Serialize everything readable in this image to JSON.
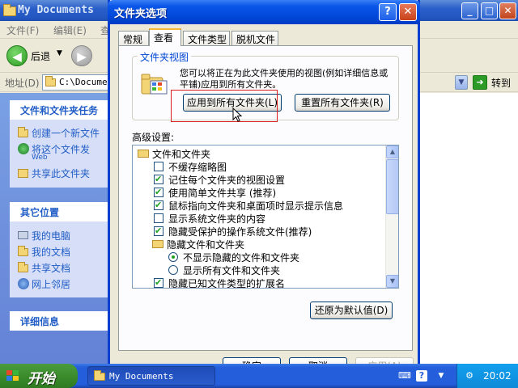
{
  "explorer": {
    "title": "My Documents",
    "menu": [
      "文件(F)",
      "编辑(E)",
      "查"
    ],
    "back_label": "后退",
    "address_label": "地址(D)",
    "address_value": "C:\\Documen",
    "go_label": "转到",
    "tasks_title": "文件和文件夹任务",
    "tasks": [
      "创建一个新文件",
      "将这个文件发",
      "Web",
      "共享此文件夹"
    ],
    "other_title": "其它位置",
    "other": [
      "我的电脑",
      "我的文档",
      "共享文档",
      "网上邻居"
    ],
    "details_title": "详细信息"
  },
  "dialog": {
    "title": "文件夹选项",
    "help_label": "?",
    "close_label": "✕",
    "tabs": [
      "常规",
      "查看",
      "文件类型",
      "脱机文件"
    ],
    "active_tab": "查看",
    "folder_view": {
      "legend": "文件夹视图",
      "description": "您可以将正在为此文件夹使用的视图(例如详细信息或平铺)应用到所有文件夹。",
      "apply_all": "应用到所有文件夹(L)",
      "reset_all": "重置所有文件夹(R)"
    },
    "advanced_label": "高级设置:",
    "advanced_items": [
      {
        "type": "folder",
        "label": "文件和文件夹"
      },
      {
        "type": "checkbox",
        "checked": false,
        "label": "不缓存缩略图"
      },
      {
        "type": "checkbox",
        "checked": true,
        "label": "记住每个文件夹的视图设置"
      },
      {
        "type": "checkbox",
        "checked": true,
        "label": "使用简单文件共享 (推荐)"
      },
      {
        "type": "checkbox",
        "checked": true,
        "label": "鼠标指向文件夹和桌面项时显示提示信息"
      },
      {
        "type": "checkbox",
        "checked": false,
        "label": "显示系统文件夹的内容"
      },
      {
        "type": "checkbox",
        "checked": true,
        "label": "隐藏受保护的操作系统文件(推荐)"
      },
      {
        "type": "folder",
        "label": "隐藏文件和文件夹"
      },
      {
        "type": "radio",
        "checked": true,
        "label": "不显示隐藏的文件和文件夹"
      },
      {
        "type": "radio",
        "checked": false,
        "label": "显示所有文件和文件夹"
      },
      {
        "type": "checkbox",
        "checked": true,
        "label": "隐藏已知文件类型的扩展名"
      }
    ],
    "restore_defaults": "还原为默认值(D)",
    "ok": "确定",
    "cancel": "取消",
    "apply": "应用(A)"
  },
  "taskbar": {
    "start": "开始",
    "window_button": "My Documents",
    "clock": "20:02"
  },
  "colors": {
    "titlebar": "#0047d8",
    "highlight_ring": "#d81e1e",
    "taskbar": "#245edb",
    "start": "#3b8c2c"
  }
}
